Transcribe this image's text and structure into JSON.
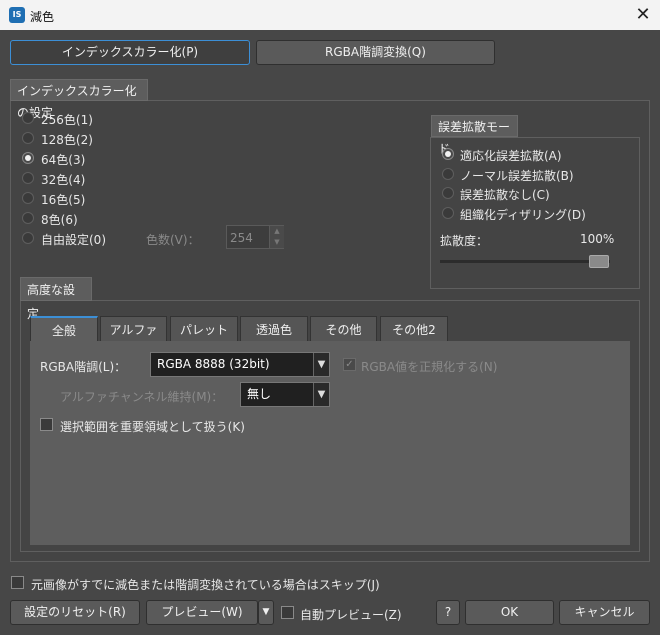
{
  "window": {
    "title": "減色",
    "app_icon": "IS",
    "close_glyph": "✕"
  },
  "mode_buttons": {
    "index_color": "インデックスカラー化(P)",
    "rgba_tone": "RGBA階調変換(Q)"
  },
  "index_settings": {
    "title": "インデックスカラー化の設定",
    "options": [
      "256色(1)",
      "128色(2)",
      "64色(3)",
      "32色(4)",
      "16色(5)",
      "8色(6)",
      "自由設定(0)"
    ],
    "selected_index": 2,
    "color_count_label": "色数(V)：",
    "color_count_value": "254"
  },
  "dither": {
    "title": "誤差拡散モード",
    "options": [
      "適応化誤差拡散(A)",
      "ノーマル誤差拡散(B)",
      "誤差拡散なし(C)",
      "組織化ディザリング(D)"
    ],
    "selected_index": 0,
    "spread_label": "拡散度：",
    "spread_value": "100%",
    "spread_fraction": 1.0
  },
  "advanced": {
    "title": "高度な設定",
    "tabs": [
      "全般",
      "アルファ",
      "パレット",
      "透過色",
      "その他",
      "その他2"
    ],
    "active_tab": 0,
    "rgba_label": "RGBA階調(L)：",
    "rgba_value": "RGBA 8888 (32bit)",
    "normalize_label": "RGBA値を正規化する(N)",
    "alpha_keep_label": "アルファチャンネル維持(M)：",
    "alpha_keep_value": "無し",
    "selection_label": "選択範囲を重要領域として扱う(K)"
  },
  "skip_label": "元画像がすでに減色または階調変換されている場合はスキップ(J)",
  "footer": {
    "reset": "設定のリセット(R)",
    "preview": "プレビュー(W)",
    "auto_preview": "自動プレビュー(Z)",
    "help": "?",
    "ok": "OK",
    "cancel": "キャンセル"
  }
}
